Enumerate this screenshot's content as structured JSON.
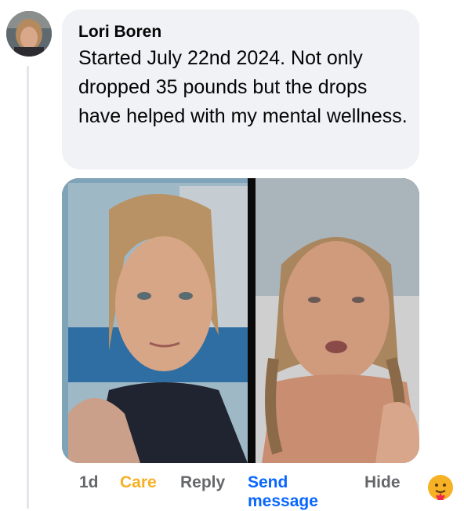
{
  "comment": {
    "author": "Lori Boren",
    "text": "Started July 22nd 2024. Not only dropped 35 pounds but the drops have helped with my mental wellness."
  },
  "actions": {
    "time": "1d",
    "reaction_label": "Care",
    "reply_label": "Reply",
    "send_message_label": "Send message",
    "hide_label": "Hide"
  },
  "icons": {
    "reaction": "care-emoji-icon"
  },
  "colors": {
    "bubble_bg": "#f0f2f5",
    "care": "#f7b125",
    "link": "#0866ff",
    "meta": "#65676b"
  }
}
